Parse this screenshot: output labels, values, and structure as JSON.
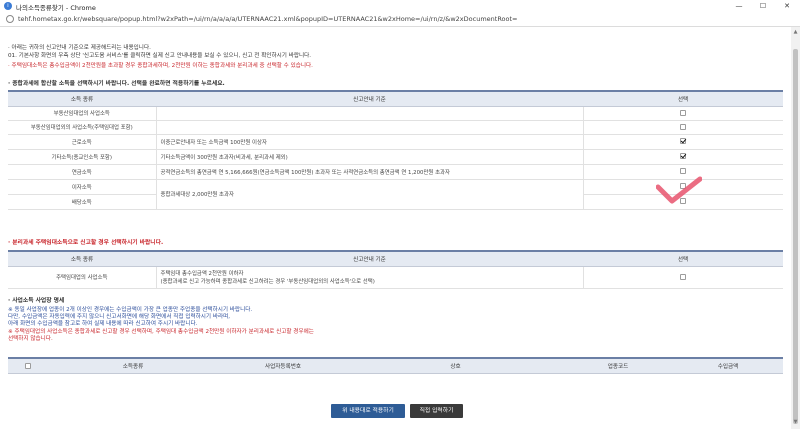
{
  "window": {
    "title": "나의소득종류찾기 - Chrome",
    "url": "tehf.hometax.go.kr/websquare/popup.html?w2xPath=/ui/rn/a/a/a/a/UTERNAAC21.xml&popupID=UTERNAAC21&w2xHome=/ui/rn/z/&w2xDocumentRoot=",
    "min_glyph": "—",
    "max_glyph": "☐",
    "close_glyph": "✕"
  },
  "notice": {
    "line1": "· 아래는 귀하의 신고안내 기준으로 제공해드리는 내용입니다.",
    "line2": "  01. 기본사항 화면의 우측 상단 '신고도움 서비스'를 클릭하면 실제 신고 안내내용을 보실 수 있으니, 신고 전 확인하시기 바랍니다.",
    "line3": "· 주택임대소득은 총수입금액이 2천만원을 초과할 경우 종합과세하며, 2천만원 이하는 종합과세와 분리과세 중 선택할 수 있습니다."
  },
  "section1": {
    "title": "· 종합과세에 합산할 소득을 선택하시기 바랍니다. 선택을 완료하면 적용하기를 누르세요.",
    "headers": [
      "소득 종류",
      "신고안내 기준",
      "선택"
    ],
    "rows": [
      {
        "name": "부동산임대업의 사업소득",
        "criteria": "",
        "checked": false
      },
      {
        "name": "부동산임대업외의 사업소득(주택임대업 포함)",
        "criteria": "",
        "checked": false
      },
      {
        "name": "근로소득",
        "criteria": "이중근로안내자 또는 소득금액 100만원 이상자",
        "checked": true
      },
      {
        "name": "기타소득(종교인소득 포함)",
        "criteria": "기타소득금액이 300만원 초과자(비과세, 분리과세 제외)",
        "checked": true
      },
      {
        "name": "연금소득",
        "criteria": "공적연금소득의 총연금액 연 5,166,666원(연금소득금액 100만원) 초과자 또는 사적연금소득의 총연금액 연 1,200만원 초과자",
        "checked": false
      },
      {
        "name": "이자소득",
        "criteria": "",
        "checked": false
      },
      {
        "name": "배당소득",
        "criteria": "",
        "checked": false
      }
    ],
    "merged_criteria": "종합과세대상 2,000만원 초과자"
  },
  "section2": {
    "title": "· 분리과세 주택임대소득으로 신고할 경우 선택하시기 바랍니다.",
    "headers": [
      "소득 종류",
      "신고안내 기준",
      "선택"
    ],
    "row_name": "주택임대업의 사업소득",
    "criteria_line1": "주택임대 총수입금액 2천만원 이하자",
    "criteria_line2": "(종합과세로 신고 가능하며 종합과세로 신고하려는 경우 '부동산임대업외의 사업소득'으로 선택)"
  },
  "section3": {
    "title": "· 사업소득 사업장 명세",
    "note1": "※ 동일 사업장에 업종이 2개 이상인 경우에는 수입금액이 가장 큰 업종만 주업종을 선택하시기 바랍니다.",
    "note2": "   다만, 수입금액은 자동입력에 주지 않으니 신고서화면에 해당 화면에서 직접 입력하시기 바라며,",
    "note3": "   아래 화면의 수입금액을 참고로 하여 실제 내용에 따라 신고하여 주시기 바랍니다.",
    "note4": "※ 주택임대업의 사업소득은 종합과세로 신고할 경우 선택하며, 주택임대 총수입금액 2천만원 이하자가 분리과세로 신고할 경우에는",
    "note5": "   선택하지 않습니다.",
    "headers": [
      "소득종류",
      "사업자등록번호",
      "상호",
      "업종코드",
      "수입금액"
    ]
  },
  "buttons": {
    "apply": "위 내용대로 적용하기",
    "direct": "직접 입력하기"
  },
  "colors": {
    "header_bg": "#e5eaf2",
    "accent_red": "#c8252b",
    "primary_button": "#2e5c96",
    "dark_button": "#3a3a3a",
    "annotation_check": "#e8536d"
  }
}
